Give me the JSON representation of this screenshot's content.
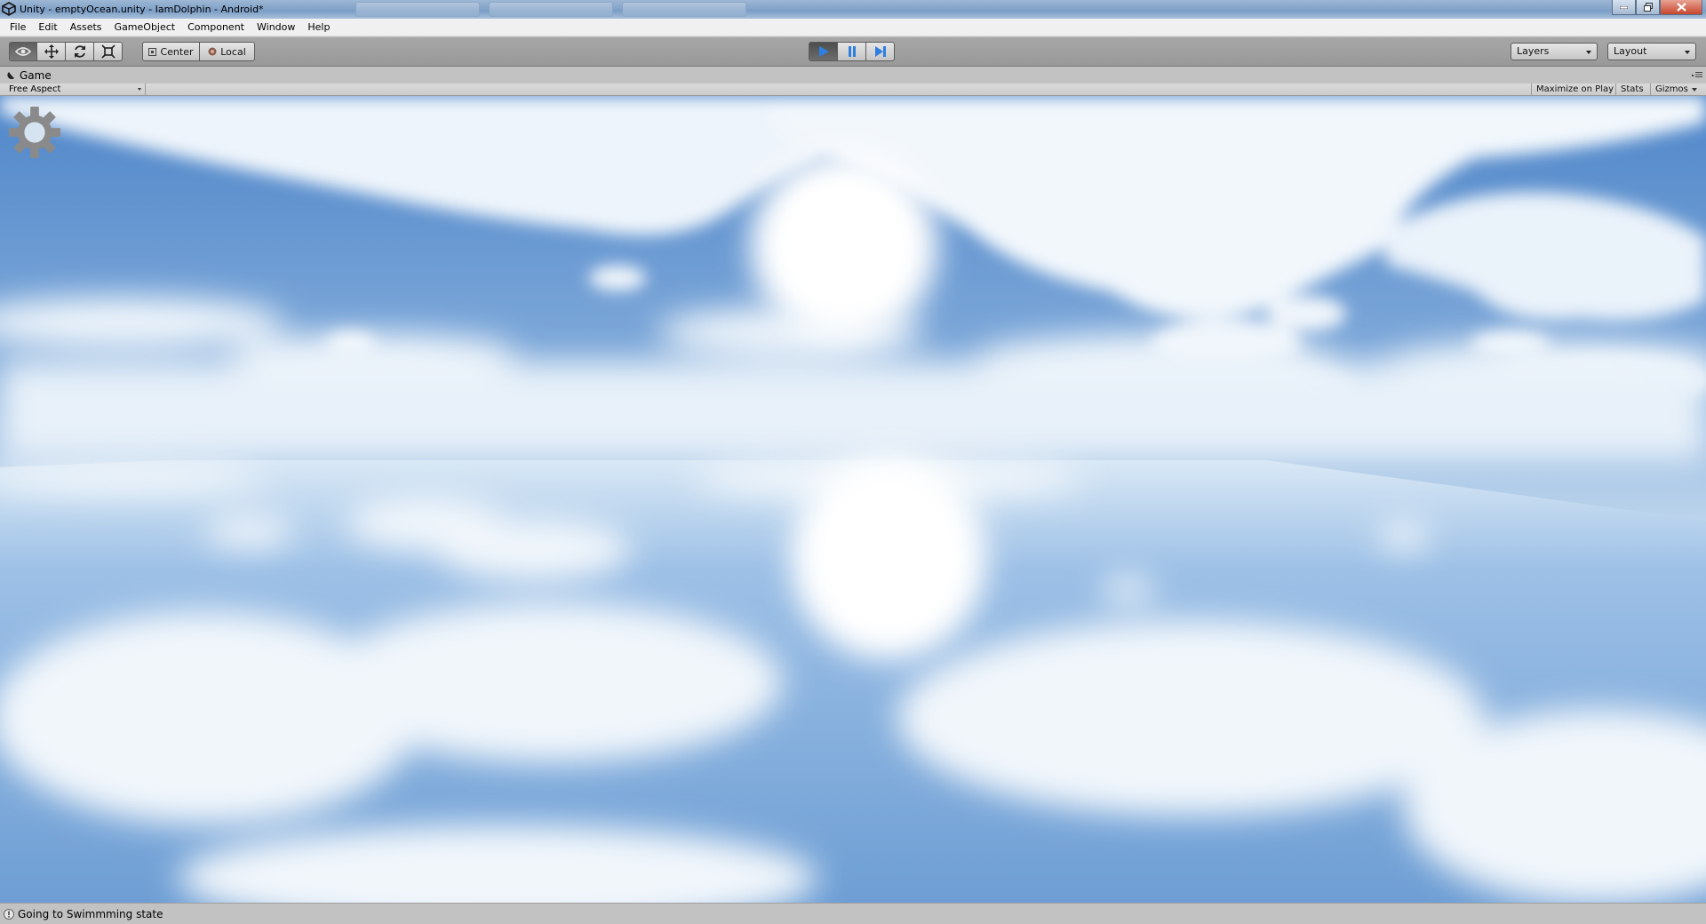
{
  "window": {
    "title": "Unity - emptyOcean.unity - IamDolphin - Android*"
  },
  "menubar": {
    "items": [
      "File",
      "Edit",
      "Assets",
      "GameObject",
      "Component",
      "Window",
      "Help"
    ]
  },
  "toolbar": {
    "tools": [
      "view-tool",
      "move-tool",
      "rotate-tool",
      "scale-tool"
    ],
    "pivot_label": "Center",
    "space_label": "Local",
    "play_state": "playing",
    "layers_label": "Layers",
    "layout_label": "Layout"
  },
  "game_panel": {
    "tab_label": "Game",
    "aspect_label": "Free Aspect",
    "maximize_label": "Maximize on Play",
    "stats_label": "Stats",
    "gizmos_label": "Gizmos"
  },
  "status": {
    "message": "Going to Swimmming state"
  },
  "colors": {
    "accent_play": "#2f7fe0",
    "sky_top": "#4f86c9",
    "sky_horizon": "#e6f0f8"
  }
}
